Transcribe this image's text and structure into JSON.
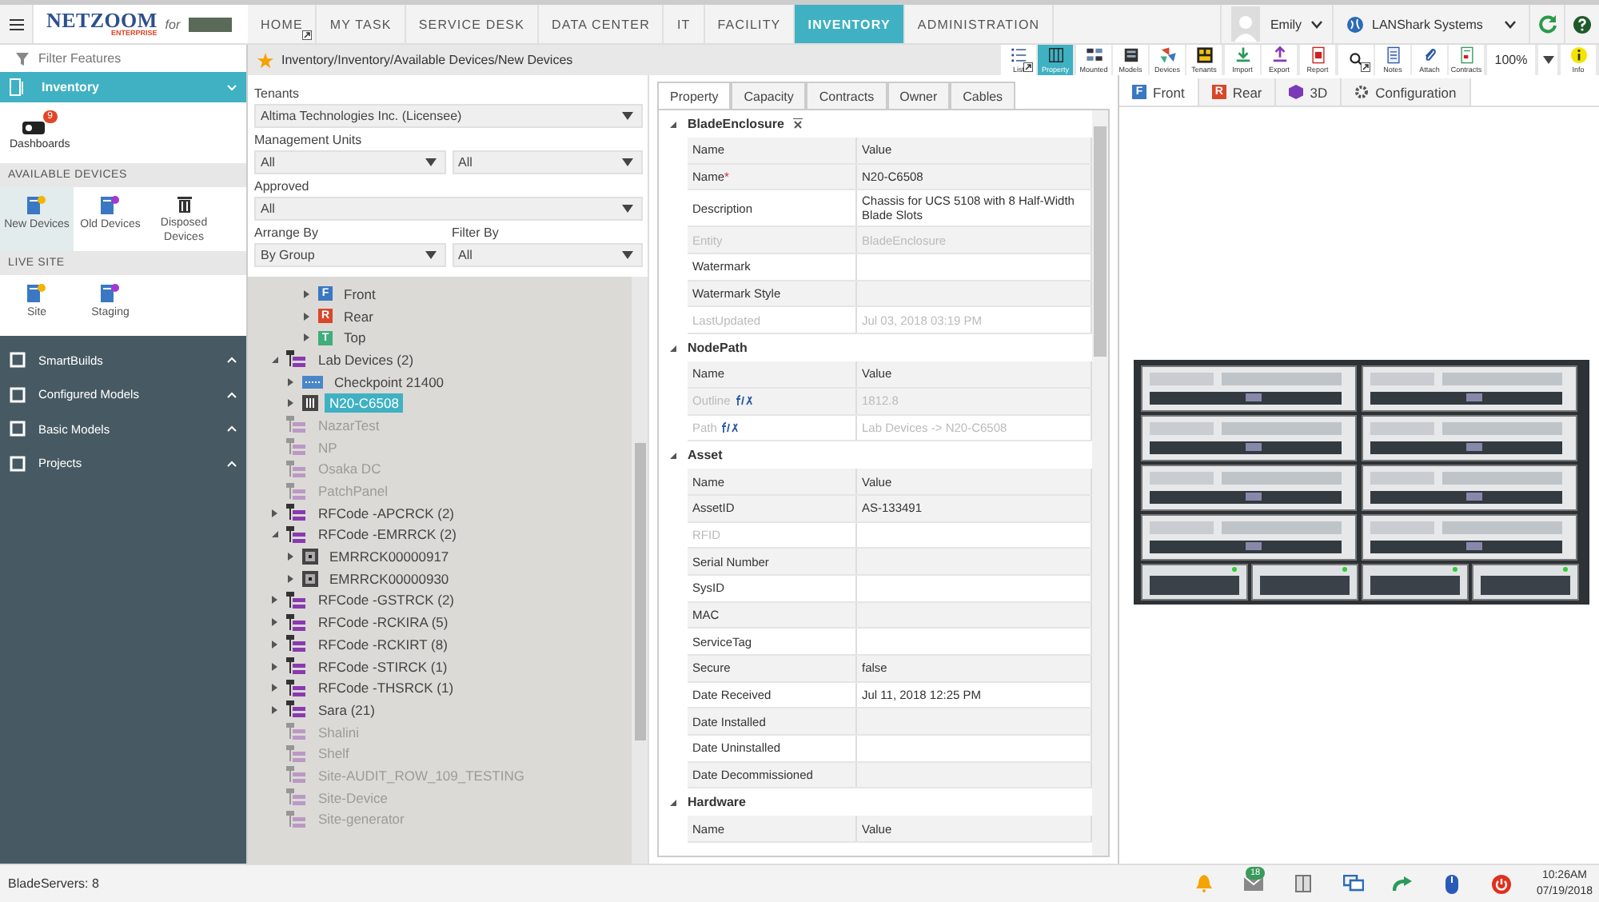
{
  "header": {
    "brand": "NETZOOM",
    "edition": "ENTERPRISE",
    "for_text": "for",
    "nav": [
      {
        "label": "HOME",
        "selected": false,
        "menu": true
      },
      {
        "label": "MY TASK",
        "selected": false,
        "menu": false
      },
      {
        "label": "SERVICE DESK",
        "selected": false,
        "menu": false
      },
      {
        "label": "DATA CENTER",
        "selected": false,
        "menu": false
      },
      {
        "label": "IT",
        "selected": false,
        "menu": false
      },
      {
        "label": "FACILITY",
        "selected": false,
        "menu": false
      },
      {
        "label": "INVENTORY",
        "selected": true,
        "menu": false
      },
      {
        "label": "ADMINISTRATION",
        "selected": false,
        "menu": false
      }
    ],
    "user": "Emily",
    "organization": "LANShark Systems"
  },
  "sidebar": {
    "filter_placeholder": "Filter Features",
    "module": "Inventory",
    "dashboards": {
      "label": "Dashboards",
      "badge": "9"
    },
    "sections": [
      {
        "title": "AVAILABLE DEVICES",
        "items": [
          {
            "label": "New Devices",
            "selected": true
          },
          {
            "label": "Old Devices",
            "selected": false
          },
          {
            "label": "Disposed Devices",
            "selected": false
          }
        ]
      },
      {
        "title": "LIVE SITE",
        "items": [
          {
            "label": "Site",
            "selected": false
          },
          {
            "label": "Staging",
            "selected": false
          }
        ]
      }
    ],
    "groups": [
      {
        "label": "SmartBuilds",
        "expanded": false
      },
      {
        "label": "Configured Models",
        "expanded": false
      },
      {
        "label": "Basic Models",
        "expanded": false
      },
      {
        "label": "Projects",
        "expanded": false
      }
    ]
  },
  "breadcrumb": "Inventory/Inventory/Available Devices/New Devices",
  "toolbar": {
    "groups": [
      [
        {
          "label": "List",
          "selected": false,
          "menu": true
        },
        {
          "label": "Property",
          "selected": true,
          "menu": false
        }
      ],
      [
        {
          "label": "Mounted",
          "selected": false,
          "menu": false
        },
        {
          "label": "Models",
          "selected": false,
          "menu": false
        },
        {
          "label": "Devices",
          "selected": false,
          "menu": false
        },
        {
          "label": "Tenants",
          "selected": false,
          "menu": false
        }
      ],
      [
        {
          "label": "Import",
          "selected": false,
          "menu": false
        },
        {
          "label": "Export",
          "selected": false,
          "menu": false
        }
      ],
      [
        {
          "label": "Report",
          "selected": false,
          "menu": false
        }
      ],
      [
        {
          "selected": false,
          "menu": true
        },
        {
          "label": "Notes",
          "selected": false,
          "menu": false
        },
        {
          "label": "Attach",
          "selected": false,
          "menu": false
        },
        {
          "label": "Contracts",
          "selected": false,
          "menu": false
        }
      ]
    ],
    "zoom": "100%",
    "info": "Info"
  },
  "filters": {
    "tenants": {
      "label": "Tenants",
      "value": "Altima Technologies Inc. (Licensee)"
    },
    "management_units": {
      "label": "Management Units",
      "values": [
        "All",
        "All"
      ]
    },
    "approved": {
      "label": "Approved",
      "value": "All"
    },
    "arrange_by": {
      "label": "Arrange By",
      "value": "By Group"
    },
    "filter_by": {
      "label": "Filter By",
      "value": "All"
    }
  },
  "tree": {
    "continued_items": [
      {
        "label": "Front",
        "badge": "F",
        "color": "#3a78c3"
      },
      {
        "label": "Rear",
        "badge": "R",
        "color": "#d9472b"
      },
      {
        "label": "Top",
        "badge": "T",
        "color": "#3fae7c"
      }
    ],
    "items": [
      {
        "label": "Lab Devices (2)",
        "kind": "group",
        "expanded": true,
        "disabled": false,
        "selected": false,
        "children": [
          {
            "label": "Checkpoint 21400",
            "kind": "switch",
            "expanded": false,
            "disabled": false,
            "selected": false
          },
          {
            "label": "N20-C6508",
            "kind": "chassis",
            "expanded": false,
            "disabled": false,
            "selected": true
          }
        ]
      },
      {
        "label": "NazarTest",
        "kind": "group",
        "disabled": true,
        "selected": false
      },
      {
        "label": "NP",
        "kind": "group",
        "disabled": true,
        "selected": false
      },
      {
        "label": "Osaka DC",
        "kind": "group",
        "disabled": true,
        "selected": false
      },
      {
        "label": "PatchPanel",
        "kind": "group",
        "disabled": true,
        "selected": false
      },
      {
        "label": "RFCode -APCRCK (2)",
        "kind": "group",
        "expanded": false,
        "disabled": false,
        "selected": false
      },
      {
        "label": "RFCode -EMRRCK (2)",
        "kind": "group",
        "expanded": true,
        "disabled": false,
        "selected": false,
        "children": [
          {
            "label": "EMRRCK00000917",
            "kind": "sensor",
            "expanded": false,
            "disabled": false,
            "selected": false
          },
          {
            "label": "EMRRCK00000930",
            "kind": "sensor",
            "expanded": false,
            "disabled": false,
            "selected": false
          }
        ]
      },
      {
        "label": "RFCode -GSTRCK (2)",
        "kind": "group",
        "expanded": false,
        "disabled": false,
        "selected": false
      },
      {
        "label": "RFCode -RCKIRA (5)",
        "kind": "group",
        "expanded": false,
        "disabled": false,
        "selected": false
      },
      {
        "label": "RFCode -RCKIRT (8)",
        "kind": "group",
        "expanded": false,
        "disabled": false,
        "selected": false
      },
      {
        "label": "RFCode -STIRCK (1)",
        "kind": "group",
        "expanded": false,
        "disabled": false,
        "selected": false
      },
      {
        "label": "RFCode -THSRCK (1)",
        "kind": "group",
        "expanded": false,
        "disabled": false,
        "selected": false
      },
      {
        "label": "Sara (21)",
        "kind": "group",
        "expanded": false,
        "disabled": false,
        "selected": false
      },
      {
        "label": "Shalini",
        "kind": "group",
        "disabled": true,
        "selected": false
      },
      {
        "label": "Shelf",
        "kind": "group",
        "disabled": true,
        "selected": false
      },
      {
        "label": "Site-AUDIT_ROW_109_TESTING",
        "kind": "group",
        "disabled": true,
        "selected": false
      },
      {
        "label": "Site-Device",
        "kind": "group",
        "disabled": true,
        "selected": false
      },
      {
        "label": "Site-generator",
        "kind": "group",
        "disabled": true,
        "selected": false
      }
    ]
  },
  "property_panel": {
    "tabs": [
      {
        "label": "Property",
        "selected": true
      },
      {
        "label": "Capacity",
        "selected": false
      },
      {
        "label": "Contracts",
        "selected": false
      },
      {
        "label": "Owner",
        "selected": false
      },
      {
        "label": "Cables",
        "selected": false
      }
    ],
    "sections": [
      {
        "title": "BladeEnclosure",
        "name_header": "Name",
        "value_header": "Value",
        "rows": [
          {
            "name": "Name",
            "required_mark": "*",
            "value": "N20-C6508",
            "disabled": false,
            "formula": false
          },
          {
            "name": "Description",
            "value": "Chassis for UCS 5108 with 8 Half-Width Blade Slots",
            "disabled": false,
            "formula": false
          },
          {
            "name": "Entity",
            "value": "BladeEnclosure",
            "disabled": true,
            "formula": false
          },
          {
            "name": "Watermark",
            "disabled": false,
            "formula": false
          },
          {
            "name": "Watermark Style",
            "disabled": false,
            "formula": false
          },
          {
            "name": "LastUpdated",
            "value": "Jul 03, 2018 03:19 PM",
            "disabled": true,
            "formula": false
          }
        ]
      },
      {
        "title": "NodePath",
        "name_header": "Name",
        "value_header": "Value",
        "rows": [
          {
            "name": "Outline",
            "value": "1812.8",
            "disabled": true,
            "formula": true
          },
          {
            "name": "Path",
            "value": "Lab Devices -> N20-C6508",
            "disabled": true,
            "formula": true
          }
        ]
      },
      {
        "title": "Asset",
        "name_header": "Name",
        "value_header": "Value",
        "rows": [
          {
            "name": "AssetID",
            "value": "AS-133491",
            "disabled": false,
            "formula": false
          },
          {
            "name": "RFID",
            "disabled": true,
            "formula": false
          },
          {
            "name": "Serial Number",
            "disabled": false,
            "formula": false
          },
          {
            "name": "SysID",
            "disabled": false,
            "formula": false
          },
          {
            "name": "MAC",
            "disabled": false,
            "formula": false
          },
          {
            "name": "ServiceTag",
            "disabled": false,
            "formula": false
          },
          {
            "name": "Secure",
            "value": "false",
            "disabled": false,
            "formula": false
          },
          {
            "name": "Date Received",
            "value": "Jul 11, 2018 12:25 PM",
            "disabled": false,
            "formula": false
          },
          {
            "name": "Date Installed",
            "disabled": false,
            "formula": false
          },
          {
            "name": "Date Uninstalled",
            "disabled": false,
            "formula": false
          },
          {
            "name": "Date Decommissioned",
            "disabled": false,
            "formula": false
          }
        ]
      },
      {
        "title": "Hardware",
        "name_header": "Name",
        "value_header": "Value"
      }
    ]
  },
  "view_panel": {
    "tabs": [
      {
        "label": "Front",
        "badge": "F",
        "color": "#3a78c3",
        "selected": true
      },
      {
        "label": "Rear",
        "badge": "R",
        "color": "#d9472b",
        "selected": false
      },
      {
        "label": "3D",
        "selected": false
      },
      {
        "label": "Configuration",
        "selected": false
      }
    ]
  },
  "status_bar": {
    "text": "BladeServers: 8",
    "messages_badge": "18",
    "time": "10:26AM",
    "date": "07/19/2018"
  }
}
